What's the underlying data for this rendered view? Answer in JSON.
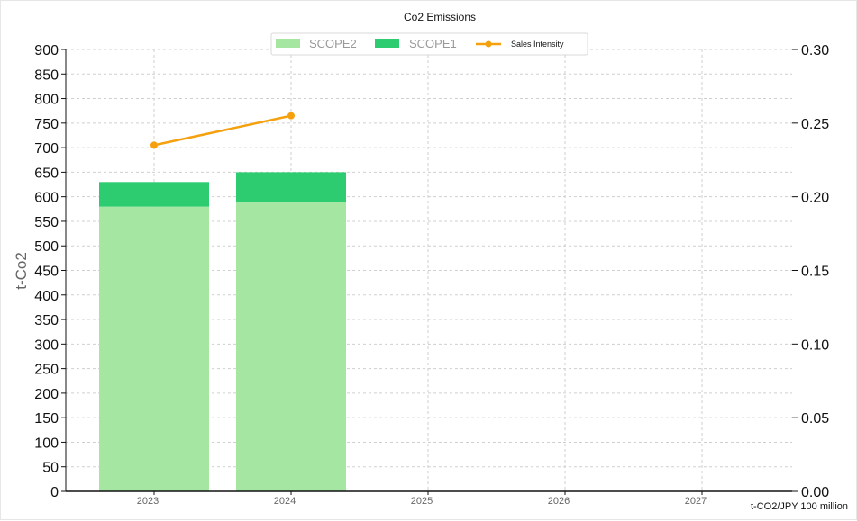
{
  "chart_data": {
    "type": "bar",
    "title": "Co2 Emissions",
    "categories": [
      "2023",
      "2024",
      "2025",
      "2026",
      "2027"
    ],
    "stacked": true,
    "series": [
      {
        "name": "SCOPE2",
        "kind": "bar",
        "color": "#a5e6a3",
        "values": [
          580,
          590,
          null,
          null,
          null
        ]
      },
      {
        "name": "SCOPE1",
        "kind": "bar",
        "color": "#2ecc71",
        "values": [
          50,
          60,
          null,
          null,
          null
        ]
      },
      {
        "name": "Sales Intensity",
        "kind": "line",
        "axis": "right",
        "color": "#f5a10f",
        "values": [
          0.235,
          0.255,
          null,
          null,
          null
        ]
      }
    ],
    "ylabel": "t-Co2",
    "y2label": "t-CO2/JPY 100 million",
    "ylim": [
      0,
      900
    ],
    "y2lim": [
      0.0,
      0.3
    ],
    "yticks": [
      "0",
      "50",
      "100",
      "150",
      "200",
      "250",
      "300",
      "350",
      "400",
      "450",
      "500",
      "550",
      "600",
      "650",
      "700",
      "750",
      "800",
      "850",
      "900"
    ],
    "y2ticks": [
      "0.00",
      "0.05",
      "0.10",
      "0.15",
      "0.20",
      "0.25",
      "0.30"
    ],
    "grid": true,
    "legend_position": "top-center"
  }
}
